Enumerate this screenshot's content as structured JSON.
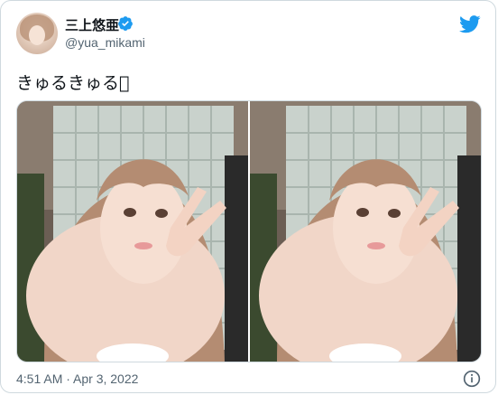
{
  "author": {
    "display_name": "三上悠亜",
    "handle": "@yua_mikami",
    "verified": true,
    "avatar_icon": "avatar-photo"
  },
  "tweet": {
    "text": "きゅるきゅる􀀀",
    "timestamp": "4:51 AM · Apr 3, 2022"
  },
  "media": {
    "count": 2,
    "photos": [
      {
        "name": "selfie-photo-1",
        "icon": "photo"
      },
      {
        "name": "selfie-photo-2",
        "icon": "photo"
      }
    ]
  },
  "icons": {
    "brand": "twitter-bird-icon",
    "verified": "verified-badge-icon",
    "info": "info-icon"
  },
  "colors": {
    "brand": "#1d9bf0",
    "text": "#0f1419",
    "secondary": "#536471",
    "border": "#cfd9de"
  }
}
